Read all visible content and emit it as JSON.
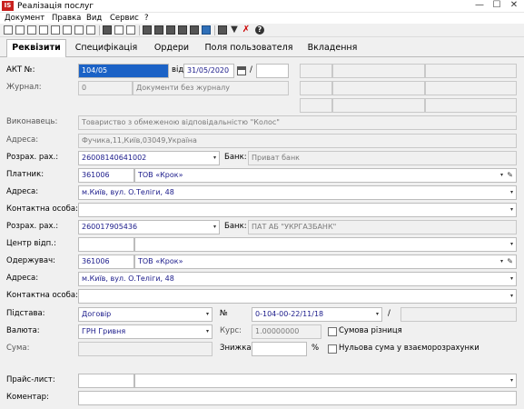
{
  "window": {
    "title": "Реалізація послуг",
    "app_icon_text": "IS"
  },
  "menu": [
    "Документ",
    "Правка",
    "Вид",
    "Сервис",
    "?"
  ],
  "tabs": [
    {
      "label": "Реквізити",
      "active": true
    },
    {
      "label": "Специфікація",
      "active": false
    },
    {
      "label": "Ордери",
      "active": false
    },
    {
      "label": "Поля пользователя",
      "active": false
    },
    {
      "label": "Вкладення",
      "active": false
    }
  ],
  "form": {
    "act_label": "АКТ №:",
    "act_number": "104/05",
    "from_label": "від",
    "act_date": "31/05/2020",
    "slash": "/",
    "journal_label": "Журнал:",
    "journal_code": "0",
    "journal_name": "Документи без журналу",
    "executor_label": "Виконавець:",
    "executor_value": "Товариство з обмеженою відповідальністю \"Колос\"",
    "executor_address_label": "Адреса:",
    "executor_address_value": "Фучика,11,Київ,03049,Україна",
    "executor_account_label": "Розрах. рах.:",
    "executor_account_value": "26008140641002",
    "executor_bank_label": "Банк:",
    "executor_bank_value": "Приват банк",
    "payer_label": "Платник:",
    "payer_code": "361006",
    "payer_name": "ТОВ «Крок»",
    "payer_address_label": "Адреса:",
    "payer_address_value": "м.Київ, вул. О.Теліги, 48",
    "payer_contact_label": "Контактна особа:",
    "payer_contact_value": "",
    "payer_account_label": "Розрах. рах.:",
    "payer_account_value": "260017905436",
    "payer_bank_label": "Банк:",
    "payer_bank_value": "ПАТ АБ \"УКРГАЗБАНК\"",
    "center_label": "Центр відп.:",
    "center_code": "",
    "center_name": "",
    "receiver_label": "Одержувач:",
    "receiver_code": "361006",
    "receiver_name": "ТОВ «Крок»",
    "receiver_address_label": "Адреса:",
    "receiver_address_value": "м.Київ, вул. О.Теліги, 48",
    "receiver_contact_label": "Контактна особа:",
    "receiver_contact_value": "",
    "basis_label": "Підстава:",
    "basis_value": "Договір",
    "number_label": "№",
    "basis_number": "0-104-00-22/11/18",
    "basis_slash": "/",
    "currency_label": "Валюта:",
    "currency_value": "ГРН Гривня",
    "rate_label": "Курс:",
    "rate_value": "1.00000000",
    "sum_diff_label": "Сумова різниця",
    "sum_label": "Сума:",
    "sum_value": "",
    "discount_label": "Знижка:",
    "discount_value": "",
    "percent_sign": "%",
    "zero_sum_label": "Нульова сума у взаєморозрахунки",
    "pricelist_label": "Прайс-лист:",
    "pricelist_code": "",
    "pricelist_name": "",
    "comment_label": "Коментар:",
    "comment_value": ""
  },
  "icons": {
    "dropdown": "▾",
    "pen": "✎",
    "help": "?",
    "close": "✕",
    "minimize": "—",
    "maximize": "☐"
  }
}
